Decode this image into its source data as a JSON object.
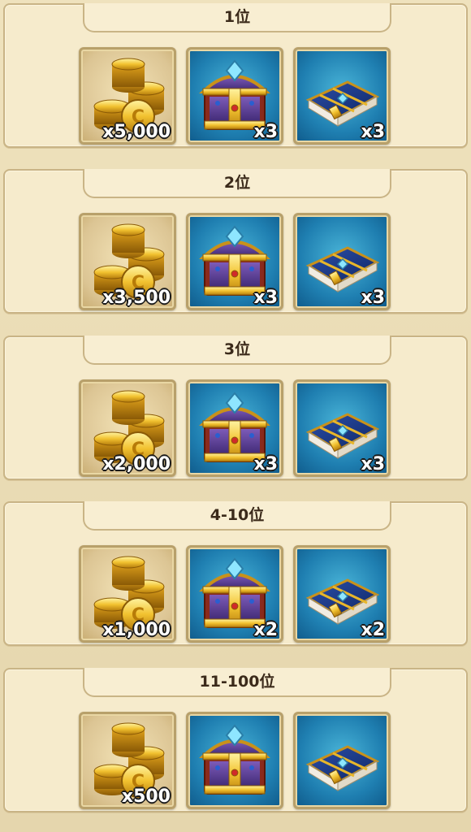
{
  "sections": [
    {
      "rank": "1位",
      "items": [
        {
          "icon": "gold-coins-icon",
          "count": "x5,000"
        },
        {
          "icon": "treasure-chest-icon",
          "count": "x3"
        },
        {
          "icon": "spell-book-icon",
          "count": "x3"
        }
      ]
    },
    {
      "rank": "2位",
      "items": [
        {
          "icon": "gold-coins-icon",
          "count": "x3,500"
        },
        {
          "icon": "treasure-chest-icon",
          "count": "x3"
        },
        {
          "icon": "spell-book-icon",
          "count": "x3"
        }
      ]
    },
    {
      "rank": "3位",
      "items": [
        {
          "icon": "gold-coins-icon",
          "count": "x2,000"
        },
        {
          "icon": "treasure-chest-icon",
          "count": "x3"
        },
        {
          "icon": "spell-book-icon",
          "count": "x3"
        }
      ]
    },
    {
      "rank": "4-10位",
      "items": [
        {
          "icon": "gold-coins-icon",
          "count": "x1,000"
        },
        {
          "icon": "treasure-chest-icon",
          "count": "x2"
        },
        {
          "icon": "spell-book-icon",
          "count": "x2"
        }
      ]
    },
    {
      "rank": "11-100位",
      "items": [
        {
          "icon": "gold-coins-icon",
          "count": "x500"
        },
        {
          "icon": "treasure-chest-icon",
          "count": ""
        },
        {
          "icon": "spell-book-icon",
          "count": ""
        }
      ]
    }
  ],
  "colors": {
    "panel": "#f6ebcc",
    "border": "#c9b486",
    "tile_blue": "#1f7fb1",
    "tile_gold": "#dcc594",
    "count_text": "#ffffff"
  }
}
